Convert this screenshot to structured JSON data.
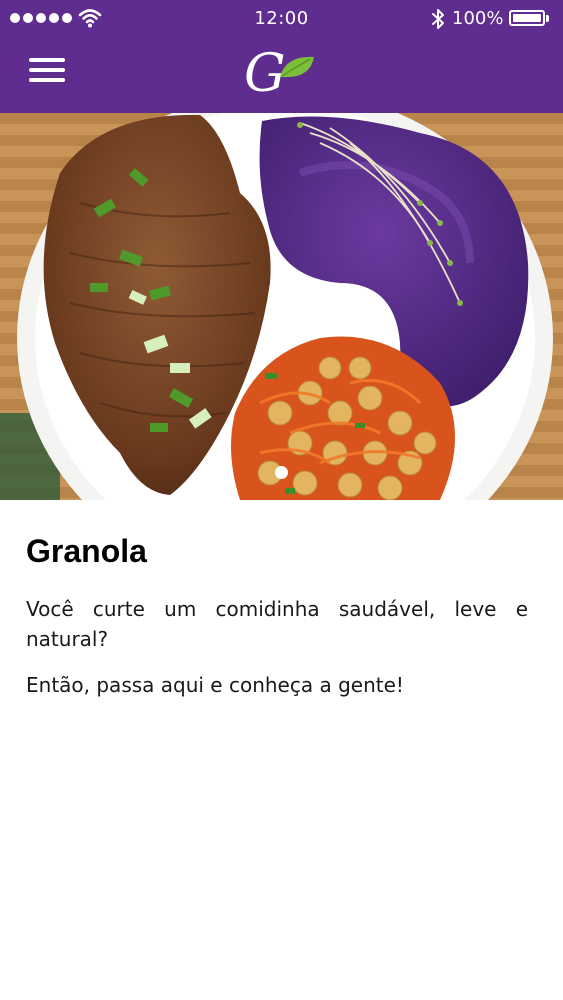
{
  "status_bar": {
    "time": "12:00",
    "battery_percent": "100%",
    "signal_bars": 5
  },
  "nav": {
    "menu_icon": "hamburger-menu-icon",
    "logo_letter": "G",
    "logo_icon": "leaf-icon"
  },
  "hero": {
    "slide_count": 1,
    "active_slide": 1
  },
  "article": {
    "title": "Granola",
    "paragraph_1": "Você curte um comidinha saudável, leve e natural?",
    "paragraph_2": "Então, passa aqui e conheça a gente!"
  },
  "colors": {
    "brand_purple": "#5e2d8f",
    "leaf_green": "#7cbf3a",
    "text": "#1a1a1a"
  }
}
